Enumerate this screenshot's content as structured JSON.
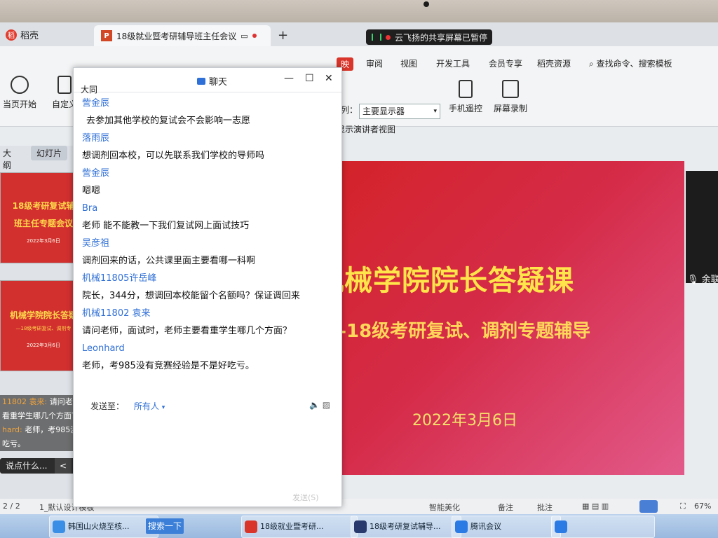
{
  "tabbar": {
    "app_name": "稻壳",
    "doc_tab": "18级就业暨考研辅导班主任会议",
    "new_tab": "+",
    "share_status": "云飞扬的共享屏幕已暂停"
  },
  "ribbon": {
    "menu": [
      "映",
      "审阅",
      "视图",
      "开发工具",
      "会员专享",
      "稻壳资源"
    ],
    "search_cmd": "查找命令、搜索模板",
    "tools": {
      "from_current": "当页开始",
      "custom": "自定义",
      "mobile_remote": "手机遥控",
      "screen_record": "屏幕录制",
      "presenter_view": "显示演讲者视图"
    },
    "monitor_label": "列：",
    "monitor_value": "主要显示器"
  },
  "left": {
    "outline_tab": "大纲",
    "slides_tab": "幻灯片",
    "thumb1": {
      "title": "18级考研复试辅",
      "title2": "班主任专题会议",
      "date": "2022年3月6日"
    },
    "thumb2": {
      "title": "机械学院院长答疑",
      "sub": "—18级考研复试、调剂专",
      "date": "2022年3月6日"
    },
    "dm": [
      {
        "name": "11802 袁来:",
        "text": " 请问老师，"
      },
      {
        "name": "",
        "text": "看重学生哪几个方面？"
      },
      {
        "name": "hard:",
        "text": " 老师，考985没有"
      },
      {
        "name": "",
        "text": "吃亏。"
      }
    ],
    "comment_placeholder": "说点什么...",
    "comment_arrow": "<",
    "add_slide": "+"
  },
  "slide": {
    "title": "机械学院院长答疑课",
    "subtitle": "—18级考研复试、调剂专题辅导",
    "date": "2022年3月6日"
  },
  "right": {
    "speaker": "余联"
  },
  "chat": {
    "title": "聊天",
    "minimize": "—",
    "maximize": "☐",
    "close": "✕",
    "top_partial": "大同",
    "messages": [
      {
        "name": "訾金辰",
        "text": "去参加其他学校的复试会不会影响一志愿"
      },
      {
        "name": "落雨辰",
        "text": "想调剂回本校，可以先联系我们学校的导师吗"
      },
      {
        "name": "訾金辰",
        "text": "嗯嗯"
      },
      {
        "name": "Bra",
        "text": "老师 能不能教一下我们复试网上面试技巧"
      },
      {
        "name": "吴彦祖",
        "text": "调剂回来的话，公共课里面主要看哪一科啊"
      },
      {
        "name": "机械11805许岳峰",
        "text": "院长，344分，想调回本校能留个名额吗？保证调回来"
      },
      {
        "name": "机械11802 袁来",
        "text": "请问老师，面试时，老师主要看重学生哪几个方面？"
      },
      {
        "name": "Leonhard",
        "text": "老师，考985没有竞赛经验是不是好吃亏。"
      }
    ],
    "send_to_label": "发送至：",
    "send_to_value": "所有人",
    "send_button": "发送(S)"
  },
  "statusbar": {
    "page": "2 / 2",
    "template": "1_默认设计模板",
    "smart": "智能美化",
    "notes": "备注",
    "comments": "批注",
    "zoom": "67%"
  },
  "taskbar": {
    "item1": "韩国山火烧至核...",
    "search": "搜索一下",
    "item2": "18级就业暨考研...",
    "item3": "18级考研复试辅导...",
    "item4": "腾讯会议",
    "item5": ""
  }
}
